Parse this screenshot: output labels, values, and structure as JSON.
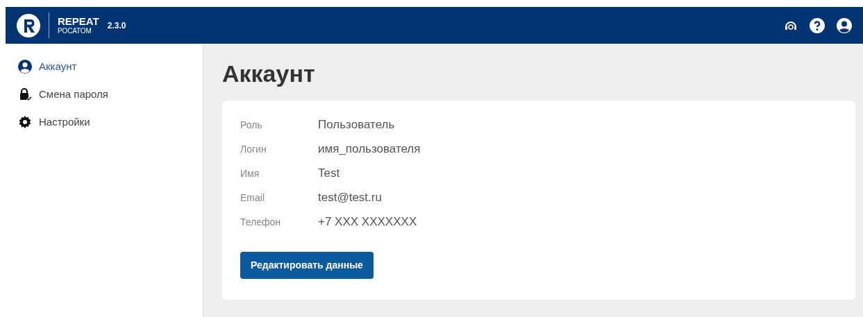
{
  "header": {
    "brand": "REPEAT",
    "sub": "РОСАТОМ",
    "version": "2.3.0"
  },
  "sidebar": {
    "items": [
      {
        "label": "Аккаунт",
        "selected": true
      },
      {
        "label": "Смена пароля",
        "selected": false
      },
      {
        "label": "Настройки",
        "selected": false
      }
    ]
  },
  "page": {
    "title": "Аккаунт",
    "fields": [
      {
        "label": "Роль",
        "value": "Пользователь"
      },
      {
        "label": "Логин",
        "value": "имя_пользователя"
      },
      {
        "label": "Имя",
        "value": "Test"
      },
      {
        "label": "Email",
        "value": "test@test.ru"
      },
      {
        "label": "Телефон",
        "value": "+7 XXX XXXXXXX"
      }
    ],
    "button": "Редактировать данные"
  }
}
